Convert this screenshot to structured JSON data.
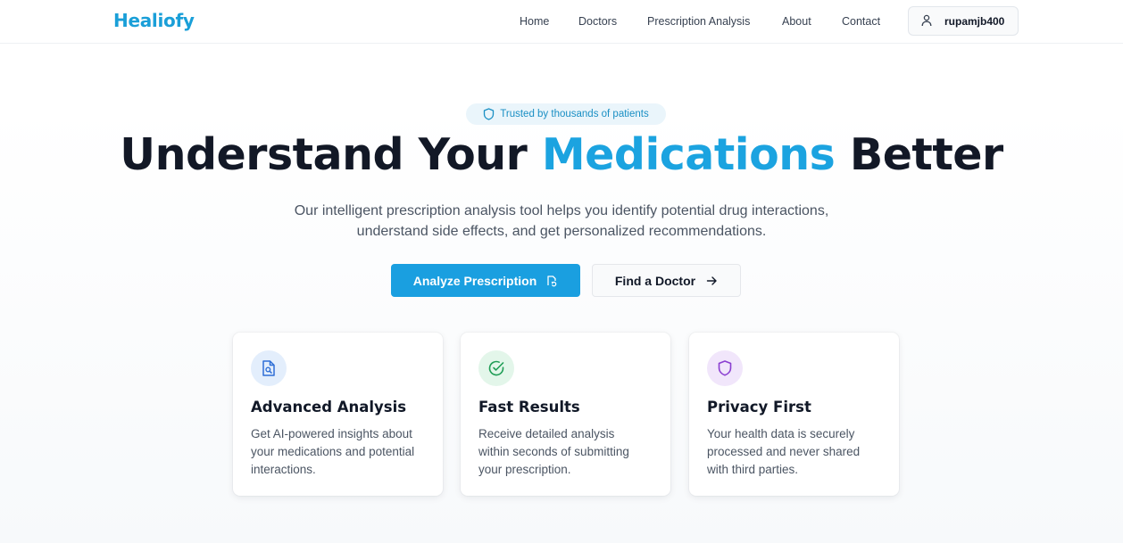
{
  "brand": {
    "name": "Healiofy",
    "color": "#1a9fd8"
  },
  "nav": {
    "links": [
      "Home",
      "Doctors",
      "Prescription Analysis",
      "About",
      "Contact"
    ],
    "user": {
      "icon": "user-icon",
      "username": "rupamjb400"
    }
  },
  "hero": {
    "badge": {
      "icon": "shield-icon",
      "text": "Trusted by thousands of patients"
    },
    "title_before": "Understand Your ",
    "title_accent": "Medications",
    "title_after": " Better",
    "subtitle_line1": "Our intelligent prescription analysis tool helps you identify potential drug interactions,",
    "subtitle_line2": "understand side effects, and get personalized recommendations.",
    "primary_button": {
      "label": "Analyze Prescription",
      "icon": "document-refresh-icon"
    },
    "secondary_button": {
      "label": "Find a Doctor",
      "icon": "arrow-right-icon"
    }
  },
  "features": [
    {
      "icon": "document-search-icon",
      "icon_color": "#2f6fd6",
      "icon_bg": "#e3eefc",
      "title": "Advanced Analysis",
      "desc_lines": [
        "Get AI-powered insights about",
        "your medications and potential",
        "interactions."
      ]
    },
    {
      "icon": "check-circle-icon",
      "icon_color": "#1f9d55",
      "icon_bg": "#e3f6ea",
      "title": "Fast Results",
      "desc_lines": [
        "Receive detailed analysis",
        "within seconds of submitting",
        "your prescription."
      ]
    },
    {
      "icon": "shield-icon",
      "icon_color": "#8b3fd1",
      "icon_bg": "#f1e6fb",
      "title": "Privacy First",
      "desc_lines": [
        "Your health data is securely",
        "processed and never shared",
        "with third parties."
      ]
    }
  ],
  "colors": {
    "accent": "#1ba3e0",
    "button_primary": "#1a9fe0",
    "heading": "#121826"
  }
}
